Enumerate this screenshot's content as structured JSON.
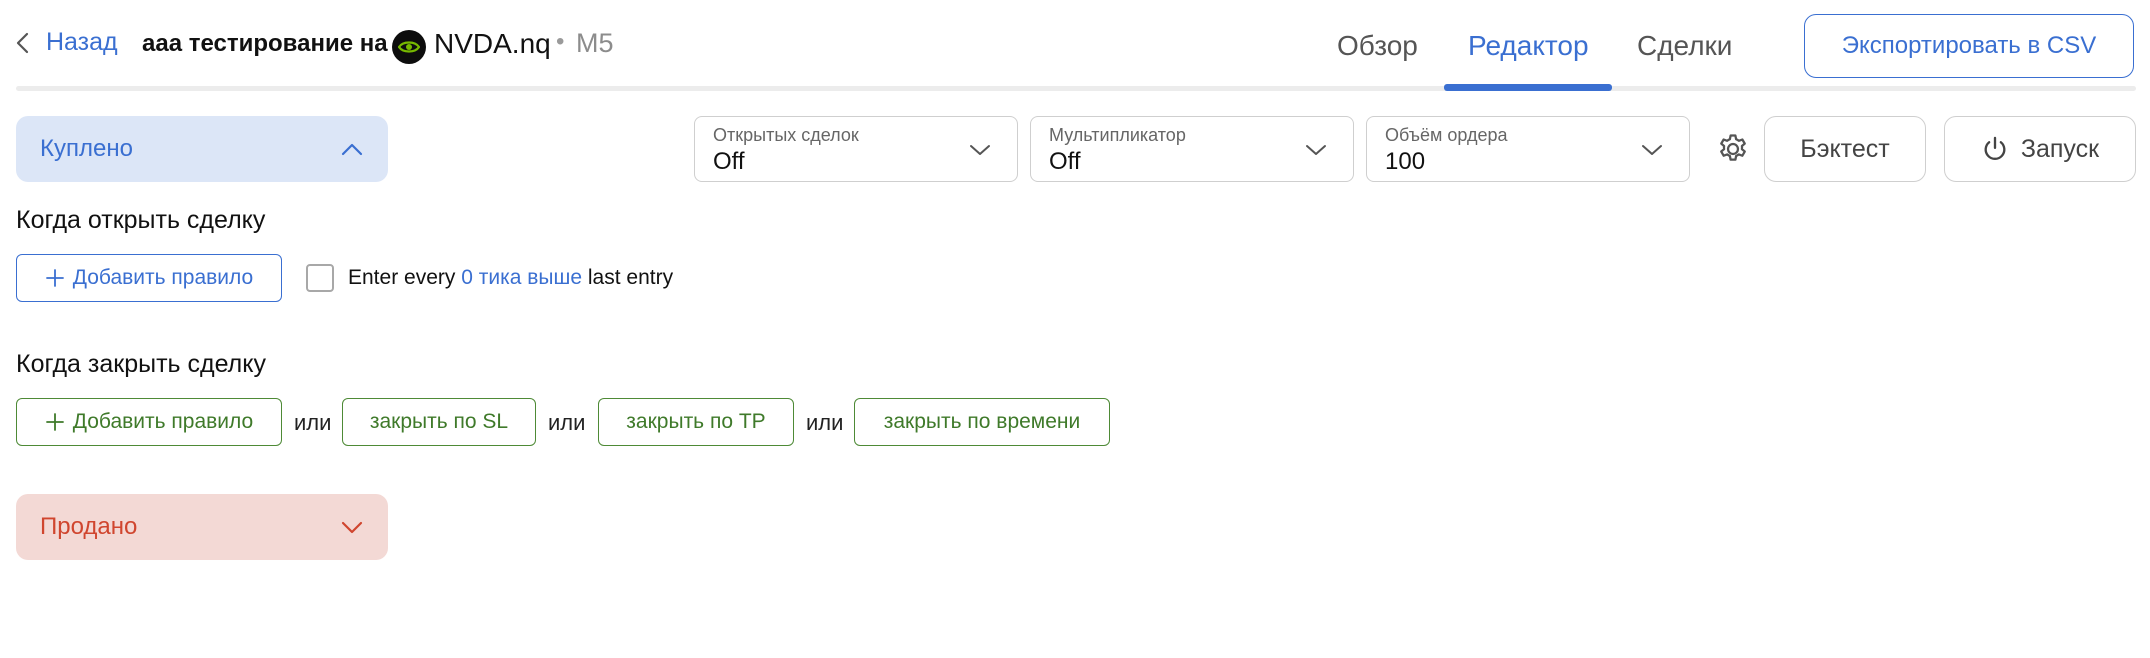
{
  "header": {
    "back_label": "Назад",
    "strategy_title": "ааа тестирование на",
    "ticker": "NVDA.nq",
    "separator": "•",
    "timeframe": "M5",
    "tabs": [
      {
        "label": "Обзор",
        "active": false
      },
      {
        "label": "Редактор",
        "active": true
      },
      {
        "label": "Сделки",
        "active": false
      }
    ],
    "export_label": "Экспортировать в CSV"
  },
  "controls": {
    "open_trades": {
      "label": "Открытых сделок",
      "value": "Off"
    },
    "multiplier": {
      "label": "Мультипликатор",
      "value": "Off"
    },
    "order_volume": {
      "label": "Объём ордера",
      "value": "100"
    },
    "backtest_label": "Бэктест",
    "launch_label": "Запуск"
  },
  "bought": {
    "label": "Куплено",
    "expanded": true,
    "open_section": {
      "title": "Когда открыть сделку",
      "add_rule_label": "Добавить правило",
      "entry_checked": false,
      "enter_prefix": "Enter every",
      "enter_link": "0 тика выше",
      "enter_suffix": "last entry"
    },
    "close_section": {
      "title": "Когда закрыть сделку",
      "add_rule_label": "Добавить правило",
      "or_label": "или",
      "close_sl_label": "закрыть по SL",
      "close_tp_label": "закрыть по TP",
      "close_time_label": "закрыть по времени"
    }
  },
  "sold": {
    "label": "Продано",
    "expanded": false
  },
  "colors": {
    "accent_blue": "#3a6fd1",
    "green": "#3f7a2a",
    "sold_red": "#d0462f",
    "bought_bg": "#dce6f7",
    "sold_bg": "#f3d9d5",
    "nvidia_green": "#76b900"
  },
  "icons": {
    "back": "chevron-left-icon",
    "logo": "nvidia-logo-icon",
    "collapse": "chevron-up-icon",
    "expand": "chevron-down-icon",
    "settings": "gear-icon",
    "launch": "power-icon",
    "add": "plus-icon"
  }
}
